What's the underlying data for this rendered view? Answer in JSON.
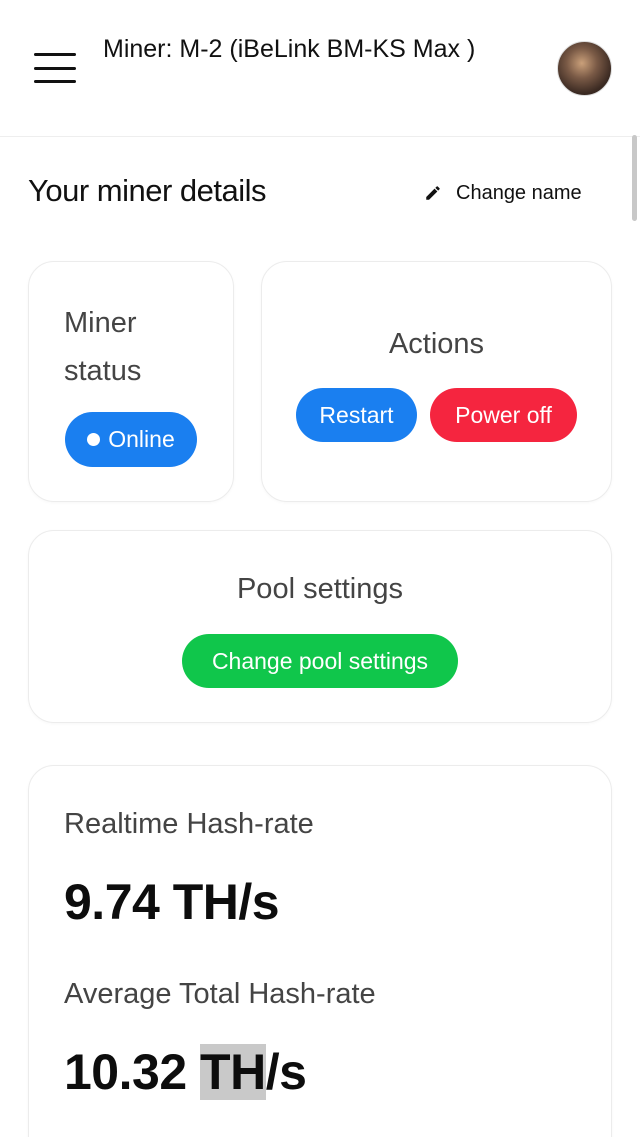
{
  "header": {
    "title": "Miner: M-2 (iBeLink BM-KS Max )",
    "menu_icon": "hamburger-menu-icon",
    "avatar_icon": "user-avatar"
  },
  "details": {
    "title": "Your miner details",
    "change_name_label": "Change name",
    "change_name_icon": "pencil-icon"
  },
  "status": {
    "label": "Miner status",
    "value": "Online",
    "color": "#1a7ff0"
  },
  "actions": {
    "label": "Actions",
    "restart_label": "Restart",
    "power_off_label": "Power off",
    "restart_color": "#1a7ff0",
    "power_off_color": "#f5253f"
  },
  "pool": {
    "label": "Pool settings",
    "button_label": "Change pool settings",
    "button_color": "#10c64b"
  },
  "hashrate": {
    "realtime_label": "Realtime Hash-rate",
    "realtime_value": "9.74 TH/s",
    "average_label": "Average Total Hash-rate",
    "average_number": "10.32",
    "average_unit_selected": "TH",
    "average_unit_rest": "/s"
  }
}
